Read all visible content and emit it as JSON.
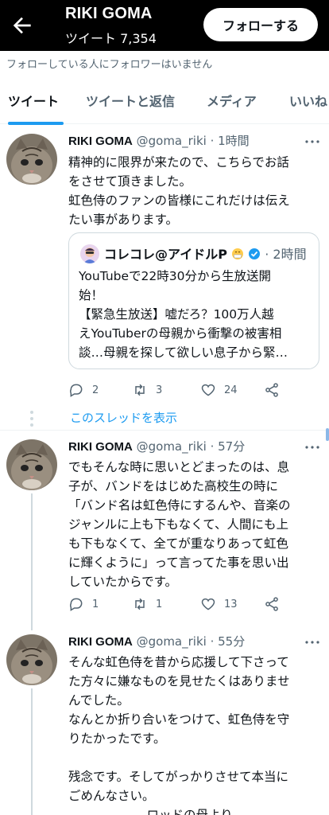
{
  "header": {
    "name": "RIKI GOMA",
    "tweet_count": "ツイート 7,354",
    "follow_label": "フォローする"
  },
  "notice": "フォローしている人にフォロワーはいません",
  "tabs": [
    "ツイート",
    "ツイートと返信",
    "メディア",
    "いいね"
  ],
  "tweets": [
    {
      "name": "RIKI GOMA",
      "handle_time": "@goma_riki · 1時間",
      "text": "精神的に限界が来たので、こちらでお話\nをさせて頂きました。\n虹色侍のファンの皆様にこれだけは伝え\nたい事があります。",
      "quote": {
        "name": "コレコレ@アイドルP",
        "time": "· 2時間",
        "text": "YouTubeで22時30分から生放送開\n始！\n【緊急生放送】嘘だろ？100万人越\nえYouTuberの母親から衝撃の被害相\n談…母親を探して欲しい息子から緊…"
      },
      "replies": "2",
      "retweets": "3",
      "likes": "24"
    },
    {
      "name": "RIKI GOMA",
      "handle_time": "@goma_riki · 57分",
      "text": "でもそんな時に思いとどまったのは、息\n子が、バンドをはじめた高校生の時に\n「バンド名は虹色侍にするんや、音楽の\nジャンルに上も下もなくて、人間にも上\nも下もなくて、全てが重なりあって虹色\nに輝くように」って言ってた事を思い出\nしていたからです。",
      "replies": "1",
      "retweets": "1",
      "likes": "13"
    },
    {
      "name": "RIKI GOMA",
      "handle_time": "@goma_riki · 55分",
      "text": "そんな虹色侍を昔から応援して下さって\nた方々に嫌なものを見せたくはありませ\nんでした。\nなんとか折り合いをつけて、虹色侍を守\nりたかったです。\n\n残念です。そしてがっかりさせて本当に\nごめんなさい。\n                    ロッドの母より"
    }
  ],
  "show_thread": "このスレッドを表示",
  "colors": {
    "accent": "#1d9bf0",
    "muted": "#536471",
    "header_bg": "#000000"
  },
  "icons": [
    "back-arrow-icon",
    "more-icon",
    "reply-icon",
    "retweet-icon",
    "like-icon",
    "share-icon",
    "verified-badge-icon",
    "emoji-icon"
  ]
}
